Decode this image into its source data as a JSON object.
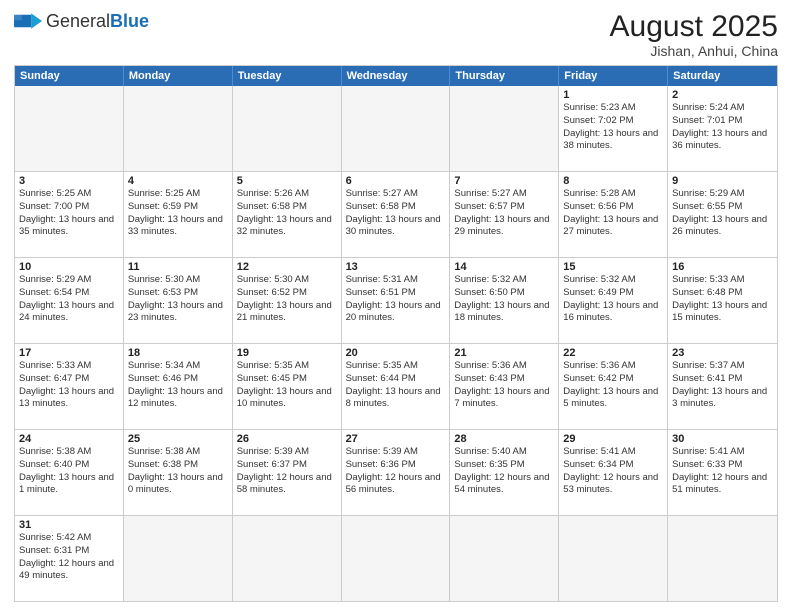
{
  "header": {
    "logo_general": "General",
    "logo_blue": "Blue",
    "month_title": "August 2025",
    "location": "Jishan, Anhui, China"
  },
  "weekdays": [
    "Sunday",
    "Monday",
    "Tuesday",
    "Wednesday",
    "Thursday",
    "Friday",
    "Saturday"
  ],
  "rows": [
    [
      {
        "day": "",
        "info": ""
      },
      {
        "day": "",
        "info": ""
      },
      {
        "day": "",
        "info": ""
      },
      {
        "day": "",
        "info": ""
      },
      {
        "day": "",
        "info": ""
      },
      {
        "day": "1",
        "info": "Sunrise: 5:23 AM\nSunset: 7:02 PM\nDaylight: 13 hours and 38 minutes."
      },
      {
        "day": "2",
        "info": "Sunrise: 5:24 AM\nSunset: 7:01 PM\nDaylight: 13 hours and 36 minutes."
      }
    ],
    [
      {
        "day": "3",
        "info": "Sunrise: 5:25 AM\nSunset: 7:00 PM\nDaylight: 13 hours and 35 minutes."
      },
      {
        "day": "4",
        "info": "Sunrise: 5:25 AM\nSunset: 6:59 PM\nDaylight: 13 hours and 33 minutes."
      },
      {
        "day": "5",
        "info": "Sunrise: 5:26 AM\nSunset: 6:58 PM\nDaylight: 13 hours and 32 minutes."
      },
      {
        "day": "6",
        "info": "Sunrise: 5:27 AM\nSunset: 6:58 PM\nDaylight: 13 hours and 30 minutes."
      },
      {
        "day": "7",
        "info": "Sunrise: 5:27 AM\nSunset: 6:57 PM\nDaylight: 13 hours and 29 minutes."
      },
      {
        "day": "8",
        "info": "Sunrise: 5:28 AM\nSunset: 6:56 PM\nDaylight: 13 hours and 27 minutes."
      },
      {
        "day": "9",
        "info": "Sunrise: 5:29 AM\nSunset: 6:55 PM\nDaylight: 13 hours and 26 minutes."
      }
    ],
    [
      {
        "day": "10",
        "info": "Sunrise: 5:29 AM\nSunset: 6:54 PM\nDaylight: 13 hours and 24 minutes."
      },
      {
        "day": "11",
        "info": "Sunrise: 5:30 AM\nSunset: 6:53 PM\nDaylight: 13 hours and 23 minutes."
      },
      {
        "day": "12",
        "info": "Sunrise: 5:30 AM\nSunset: 6:52 PM\nDaylight: 13 hours and 21 minutes."
      },
      {
        "day": "13",
        "info": "Sunrise: 5:31 AM\nSunset: 6:51 PM\nDaylight: 13 hours and 20 minutes."
      },
      {
        "day": "14",
        "info": "Sunrise: 5:32 AM\nSunset: 6:50 PM\nDaylight: 13 hours and 18 minutes."
      },
      {
        "day": "15",
        "info": "Sunrise: 5:32 AM\nSunset: 6:49 PM\nDaylight: 13 hours and 16 minutes."
      },
      {
        "day": "16",
        "info": "Sunrise: 5:33 AM\nSunset: 6:48 PM\nDaylight: 13 hours and 15 minutes."
      }
    ],
    [
      {
        "day": "17",
        "info": "Sunrise: 5:33 AM\nSunset: 6:47 PM\nDaylight: 13 hours and 13 minutes."
      },
      {
        "day": "18",
        "info": "Sunrise: 5:34 AM\nSunset: 6:46 PM\nDaylight: 13 hours and 12 minutes."
      },
      {
        "day": "19",
        "info": "Sunrise: 5:35 AM\nSunset: 6:45 PM\nDaylight: 13 hours and 10 minutes."
      },
      {
        "day": "20",
        "info": "Sunrise: 5:35 AM\nSunset: 6:44 PM\nDaylight: 13 hours and 8 minutes."
      },
      {
        "day": "21",
        "info": "Sunrise: 5:36 AM\nSunset: 6:43 PM\nDaylight: 13 hours and 7 minutes."
      },
      {
        "day": "22",
        "info": "Sunrise: 5:36 AM\nSunset: 6:42 PM\nDaylight: 13 hours and 5 minutes."
      },
      {
        "day": "23",
        "info": "Sunrise: 5:37 AM\nSunset: 6:41 PM\nDaylight: 13 hours and 3 minutes."
      }
    ],
    [
      {
        "day": "24",
        "info": "Sunrise: 5:38 AM\nSunset: 6:40 PM\nDaylight: 13 hours and 1 minute."
      },
      {
        "day": "25",
        "info": "Sunrise: 5:38 AM\nSunset: 6:38 PM\nDaylight: 13 hours and 0 minutes."
      },
      {
        "day": "26",
        "info": "Sunrise: 5:39 AM\nSunset: 6:37 PM\nDaylight: 12 hours and 58 minutes."
      },
      {
        "day": "27",
        "info": "Sunrise: 5:39 AM\nSunset: 6:36 PM\nDaylight: 12 hours and 56 minutes."
      },
      {
        "day": "28",
        "info": "Sunrise: 5:40 AM\nSunset: 6:35 PM\nDaylight: 12 hours and 54 minutes."
      },
      {
        "day": "29",
        "info": "Sunrise: 5:41 AM\nSunset: 6:34 PM\nDaylight: 12 hours and 53 minutes."
      },
      {
        "day": "30",
        "info": "Sunrise: 5:41 AM\nSunset: 6:33 PM\nDaylight: 12 hours and 51 minutes."
      }
    ],
    [
      {
        "day": "31",
        "info": "Sunrise: 5:42 AM\nSunset: 6:31 PM\nDaylight: 12 hours and 49 minutes."
      },
      {
        "day": "",
        "info": ""
      },
      {
        "day": "",
        "info": ""
      },
      {
        "day": "",
        "info": ""
      },
      {
        "day": "",
        "info": ""
      },
      {
        "day": "",
        "info": ""
      },
      {
        "day": "",
        "info": ""
      }
    ]
  ]
}
